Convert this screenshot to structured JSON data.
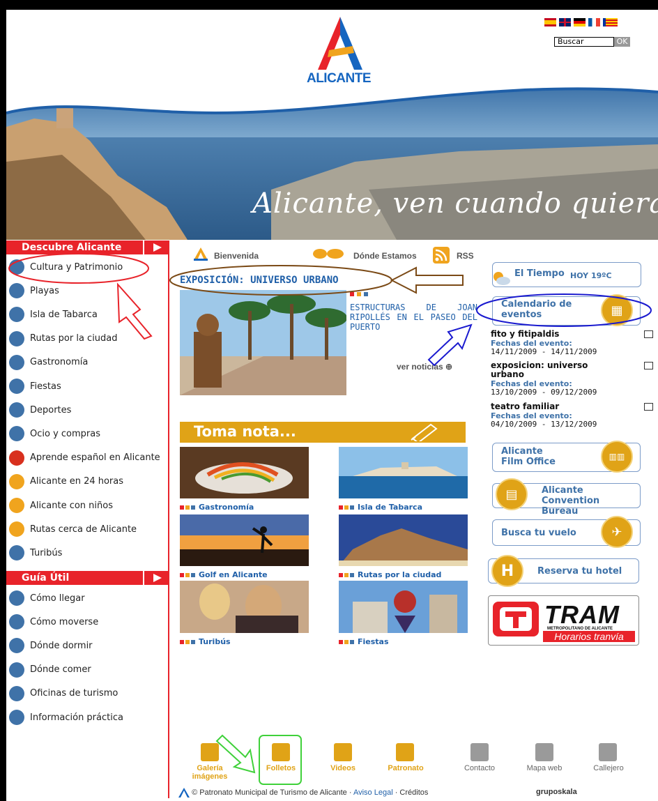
{
  "header": {
    "logo_text": "ALICANTE",
    "search_placeholder": "Buscar",
    "search_button": "OK",
    "slogan": "Alicante, ven cuando quieras",
    "flags": [
      "spanish-flag-icon",
      "english-flag-icon",
      "german-flag-icon",
      "french-flag-icon",
      "valencian-flag-icon"
    ]
  },
  "sidebar": {
    "section1_title": "Descubre Alicante",
    "section1_items": [
      {
        "label": "Cultura y Patrimonio",
        "icon": "monument-icon"
      },
      {
        "label": "Playas",
        "icon": "beach-icon"
      },
      {
        "label": "Isla de Tabarca",
        "icon": "island-icon"
      },
      {
        "label": "Rutas por la ciudad",
        "icon": "route-icon"
      },
      {
        "label": "Gastronomía",
        "icon": "cutlery-icon"
      },
      {
        "label": "Fiestas",
        "icon": "fire-icon"
      },
      {
        "label": "Deportes",
        "icon": "sports-icon"
      },
      {
        "label": "Ocio y compras",
        "icon": "shopping-icon"
      },
      {
        "label": "Aprende español en Alicante",
        "icon": "book-icon"
      },
      {
        "label": "Alicante en 24 horas",
        "icon": "clock-icon"
      },
      {
        "label": "Alicante con niños",
        "icon": "family-icon"
      },
      {
        "label": "Rutas cerca de Alicante",
        "icon": "hiking-icon"
      },
      {
        "label": "Turibús",
        "icon": "bus-icon"
      }
    ],
    "section2_title": "Guía Útil",
    "section2_items": [
      {
        "label": "Cómo llegar",
        "icon": "bus-icon"
      },
      {
        "label": "Cómo moverse",
        "icon": "car-icon"
      },
      {
        "label": "Dónde dormir",
        "icon": "bed-icon"
      },
      {
        "label": "Dónde comer",
        "icon": "plate-icon"
      },
      {
        "label": "Oficinas de turismo",
        "icon": "tourism-office-icon"
      },
      {
        "label": "Información práctica",
        "icon": "info-icon"
      }
    ]
  },
  "tabs": {
    "welcome": "Bienvenida",
    "where": "Dónde Estamos",
    "rss": "RSS"
  },
  "news": {
    "title": "EXPOSICIÓN: UNIVERSO URBANO",
    "text": "ESTRUCTURAS DE JOAN RIPOLLÉS EN EL PASEO DEL PUERTO",
    "more": "ver noticias ⊕"
  },
  "toma_nota": {
    "title": "Toma nota...",
    "items": [
      "Gastronomía",
      "Isla de Tabarca",
      "Golf en Alicante",
      "Rutas por la ciudad",
      "Turibús",
      "Fiestas"
    ]
  },
  "right": {
    "weather_label": "El Tiempo",
    "weather_value": "HOY 19ºC",
    "calendar_label": "Calendario de eventos",
    "events": [
      {
        "title": "fito y fitipaldis",
        "label": "Fechas del evento:",
        "dates": "14/11/2009 - 14/11/2009"
      },
      {
        "title": "exposicion: universo urbano",
        "label": "Fechas del evento:",
        "dates": "13/10/2009 - 09/12/2009"
      },
      {
        "title": "teatro familiar",
        "label": "Fechas del evento:",
        "dates": "04/10/2009 - 13/12/2009"
      }
    ],
    "film_office": "Alicante Film Office",
    "convention": "Alicante Convention Bureau",
    "flight": "Busca tu vuelo",
    "hotel": "Reserva tu hotel",
    "tram_logo": "TRAM",
    "tram_sub": "METROPOLITANO DE ALICANTE",
    "tram_hours": "Horarios tranvía"
  },
  "footer": {
    "icons": [
      {
        "label": "Galería imágenes",
        "icon": "camera-icon"
      },
      {
        "label": "Folletos",
        "icon": "brochure-icon"
      },
      {
        "label": "Videos",
        "icon": "video-icon"
      },
      {
        "label": "Patronato",
        "icon": "patronato-icon"
      },
      {
        "label": "Contacto",
        "icon": "phone-icon"
      },
      {
        "label": "Mapa web",
        "icon": "sitemap-icon"
      },
      {
        "label": "Callejero",
        "icon": "street-map-icon"
      }
    ],
    "copyright": "© Patronato Municipal de Turismo de Alicante · ",
    "legal": "Aviso Legal",
    "credits": " · Créditos",
    "brand": "gruposkala"
  },
  "colors": {
    "red": "#e8232a",
    "blue": "#3f72a8",
    "orange": "#e0a317",
    "link": "#1f5fa8"
  }
}
